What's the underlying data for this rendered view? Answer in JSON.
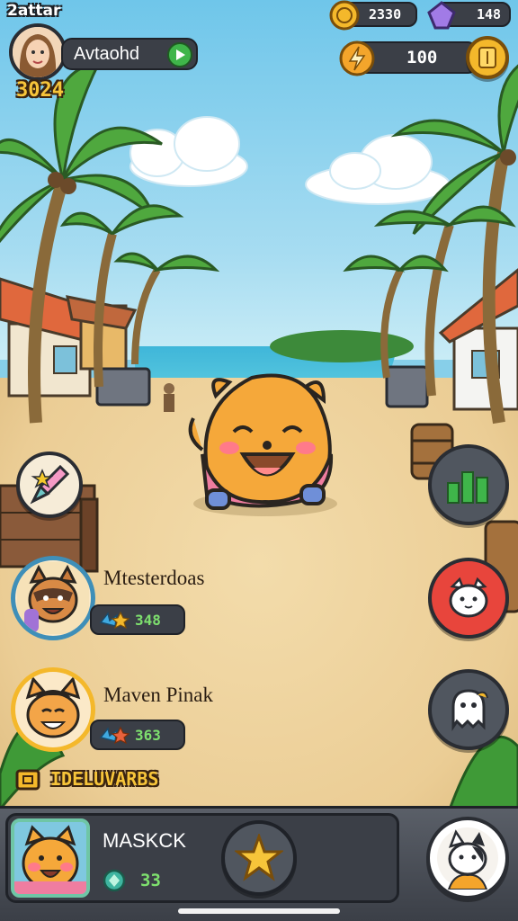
{
  "status_bar": {
    "carrier": "2attar"
  },
  "player": {
    "name": "Avtaohd",
    "level_score": "3024",
    "avatar_icon": "woman-portrait-icon",
    "play_icon": "play-arrow-icon"
  },
  "currencies": {
    "coins": {
      "value": "2330",
      "icon": "gold-coin-icon"
    },
    "gems": {
      "value": "148",
      "icon": "purple-gem-icon"
    },
    "energy": {
      "value": "100",
      "icon": "coin-bolt-icon",
      "plus_icon": "gold-card-icon"
    }
  },
  "friends": [
    {
      "name": "Mtesterdoas",
      "score": "348",
      "avatar_icon": "raccoon-avatar-icon",
      "badge_icon": "bird-badge-icon"
    },
    {
      "name": "Maven Pinak",
      "score": "363",
      "avatar_icon": "cat-avatar-icon",
      "badge_icon": "bird-badge-icon"
    }
  ],
  "deliveries_label": "IDELUVARBS",
  "side_buttons": [
    {
      "name": "pencil-tool",
      "icon": "pencil-icon"
    },
    {
      "name": "stats",
      "icon": "bar-chart-icon"
    },
    {
      "name": "pet-red",
      "icon": "white-cat-icon"
    },
    {
      "name": "ghost",
      "icon": "ghost-icon"
    }
  ],
  "bottom_bar": {
    "pet_name": "MASKCK",
    "pet_value": "33",
    "pet_icon": "hamster-portrait-icon",
    "value_icon": "green-gem-icon",
    "center_icon": "star-icon",
    "right_icon": "cat-portrait-icon"
  },
  "colors": {
    "chip_bg": "#3b3f47",
    "accent_green": "#3fb54a",
    "accent_red": "#e8453c",
    "gold": "#f4b82b",
    "sand": "#ebcd95",
    "sky": "#87cfe9"
  }
}
